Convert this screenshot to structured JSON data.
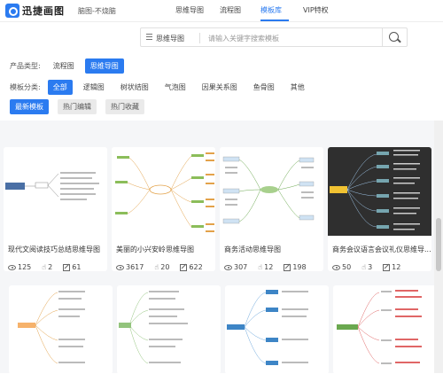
{
  "header": {
    "logo_text": "迅捷画图",
    "tagline": "脑图-不烧脑",
    "nav": [
      {
        "label": "思维导图",
        "active": false
      },
      {
        "label": "流程图",
        "active": false
      },
      {
        "label": "模板库",
        "active": true
      },
      {
        "label": "VIP特权",
        "active": false
      }
    ]
  },
  "search": {
    "type_label": "思维导图",
    "placeholder": "请输入关键字搜索模板"
  },
  "filters": {
    "product_label": "产品类型:",
    "product_types": [
      {
        "label": "流程图",
        "active": false
      },
      {
        "label": "思维导图",
        "active": true
      }
    ],
    "category_label": "模板分类:",
    "categories": [
      {
        "label": "全部",
        "active": true
      },
      {
        "label": "逻辑图",
        "active": false
      },
      {
        "label": "树状结图",
        "active": false
      },
      {
        "label": "气泡图",
        "active": false
      },
      {
        "label": "因果关系图",
        "active": false
      },
      {
        "label": "鱼骨图",
        "active": false
      },
      {
        "label": "其他",
        "active": false
      }
    ],
    "sort": [
      {
        "label": "最新模板",
        "active": true
      },
      {
        "label": "热门编辑",
        "active": false
      },
      {
        "label": "热门收藏",
        "active": false
      }
    ]
  },
  "cards": [
    {
      "title": "现代文阅读技巧总结思维导图",
      "views": "125",
      "likes": "2",
      "edits": "61"
    },
    {
      "title": "美丽的小兴安岭思维导图",
      "views": "3617",
      "likes": "20",
      "edits": "622"
    },
    {
      "title": "商务活动思维导图",
      "views": "307",
      "likes": "12",
      "edits": "198"
    },
    {
      "title": "商务会议语言会议礼仪思维导...",
      "views": "50",
      "likes": "3",
      "edits": "12"
    }
  ],
  "colors": {
    "accent": "#2b7bf0"
  }
}
